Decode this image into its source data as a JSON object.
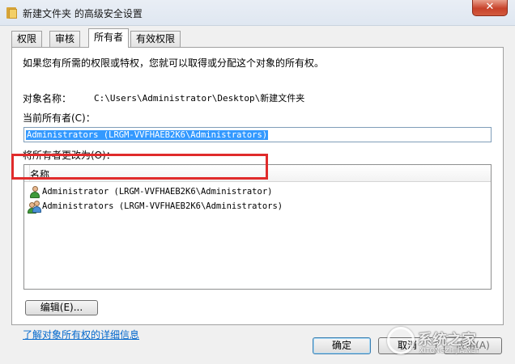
{
  "window": {
    "title": "新建文件夹 的高级安全设置",
    "close_symbol": "✕"
  },
  "tabs": [
    {
      "label": "权限",
      "active": false
    },
    {
      "label": "审核",
      "active": false
    },
    {
      "label": "所有者",
      "active": true
    },
    {
      "label": "有效权限",
      "active": false
    }
  ],
  "owner_tab": {
    "intro": "如果您有所需的权限或特权，您就可以取得或分配这个对象的所有权。",
    "object_name_label": "对象名称：",
    "object_name_value": "C:\\Users\\Administrator\\Desktop\\新建文件夹",
    "current_owner_label": "当前所有者(C)：",
    "current_owner_value": "Administrators (LRGM-VVFHAEB2K6\\Administrators)",
    "change_owner_label": "将所有者更改为(O)：",
    "list_column_header": "名称",
    "owner_candidates": [
      {
        "name": "Administrator (LRGM-VVFHAEB2K6\\Administrator)",
        "icon": "user-icon",
        "highlighted": true
      },
      {
        "name": "Administrators (LRGM-VVFHAEB2K6\\Administrators)",
        "icon": "users-icon",
        "highlighted": false
      }
    ],
    "edit_button": "编辑(E)...",
    "learn_more_link": "了解对象所有权的详细信息"
  },
  "buttons": {
    "ok": "确定",
    "cancel": "取消",
    "apply": "应用(A)"
  },
  "colors": {
    "highlight_box": "#e02b2b",
    "selection": "#3399ff",
    "link": "#0066cc"
  }
}
